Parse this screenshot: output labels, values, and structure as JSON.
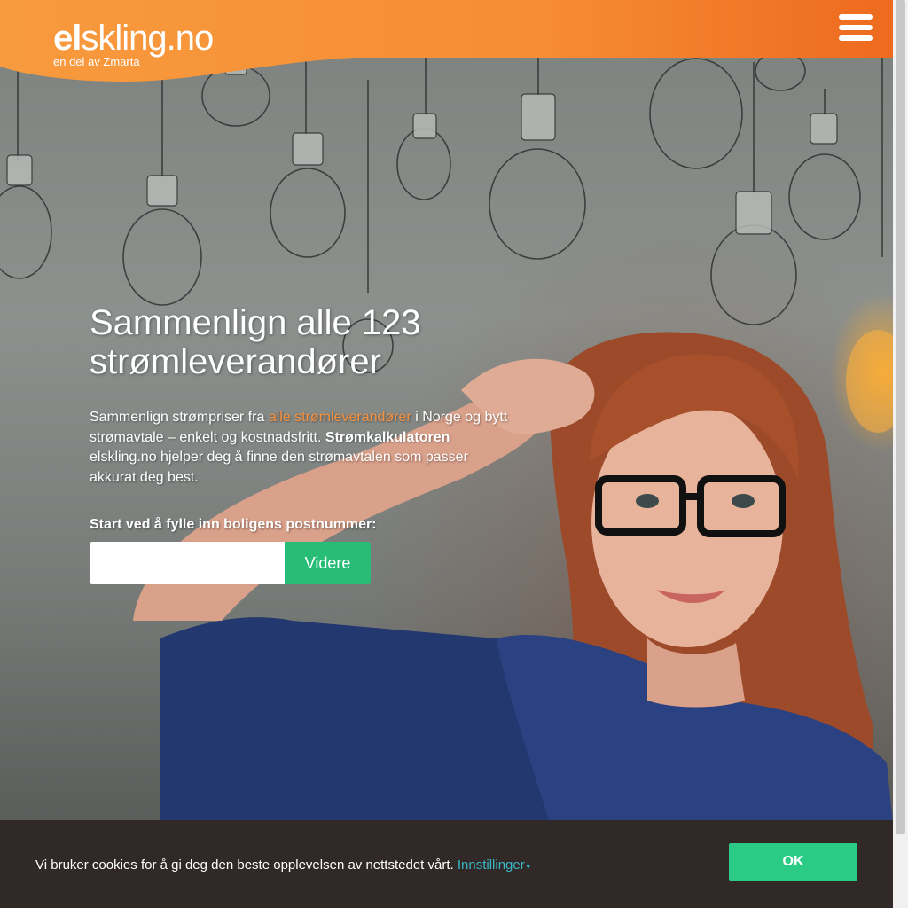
{
  "header": {
    "logo_el": "el",
    "logo_rest": "skling.no",
    "logo_sub": "en del av Zmarta"
  },
  "hero": {
    "headline": "Sammenlign alle 123 strømleverandører",
    "intro_part1": "Sammenlign strømpriser fra ",
    "intro_link": "alle strømleverandører",
    "intro_part2": " i Norge og bytt strømavtale – enkelt og kostnadsfritt. ",
    "intro_bold": "Strømkalkulatoren",
    "intro_part3": " elskling.no hjelper deg å finne den strømavtalen som passer akkurat deg best.",
    "postal_label": "Start ved å fylle inn boligens postnummer:",
    "postal_value": "",
    "submit_label": "Videre"
  },
  "cookie": {
    "text": "Vi bruker cookies for å gi deg den beste opplevelsen av nettstedet vårt. ",
    "settings_link": "Innstillinger",
    "ok_label": "OK"
  },
  "colors": {
    "header_orange": "#f7913d",
    "header_orange_dark": "#ef6a1e",
    "cta_green": "#27bd77",
    "ok_green": "#2bcb85",
    "cookie_bg": "#302928",
    "link_teal": "#3ab7c5"
  },
  "icons": {
    "menu": "hamburger-menu-icon",
    "settings_caret": "caret-down-icon"
  }
}
